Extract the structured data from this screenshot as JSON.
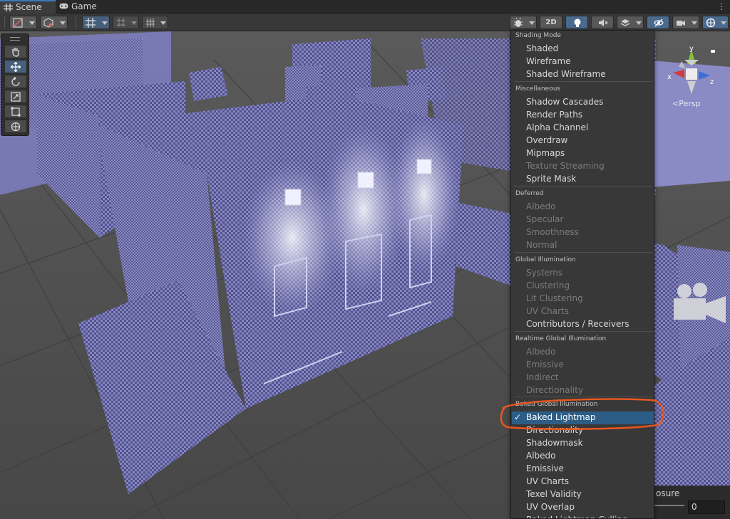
{
  "tabs": [
    {
      "label": "Scene",
      "icon": "scene-hash-icon",
      "active": true
    },
    {
      "label": "Game",
      "icon": "gamepad-icon",
      "active": false
    }
  ],
  "toolbar": {
    "render_mode_2d_label": "2D",
    "icons": [
      "draw-mode-icon",
      "shaded-cube-icon",
      "grid-snap-icon",
      "increment-snap-icon",
      "grid-icon",
      "debug-bug-icon",
      "light-bulb-icon",
      "audio-mute-icon",
      "effects-layers-icon",
      "visibility-off-icon",
      "camera-icon",
      "gizmos-globe-icon"
    ]
  },
  "tools": [
    "hand-tool-icon",
    "move-tool-icon",
    "rotate-tool-icon",
    "scale-tool-icon",
    "rect-tool-icon",
    "transform-tool-icon"
  ],
  "gizmo": {
    "label": "Persp",
    "axes": {
      "x": "x",
      "y": "y",
      "z": "z"
    },
    "colors": {
      "x": "#d23b3b",
      "y": "#7ec43c",
      "z": "#3b6fd6"
    }
  },
  "menu": {
    "sections": [
      {
        "header": "Shading Mode",
        "items": [
          {
            "label": "Shaded",
            "enabled": true
          },
          {
            "label": "Wireframe",
            "enabled": true
          },
          {
            "label": "Shaded Wireframe",
            "enabled": true
          }
        ]
      },
      {
        "header": "Miscellaneous",
        "items": [
          {
            "label": "Shadow Cascades",
            "enabled": true
          },
          {
            "label": "Render Paths",
            "enabled": true
          },
          {
            "label": "Alpha Channel",
            "enabled": true
          },
          {
            "label": "Overdraw",
            "enabled": true
          },
          {
            "label": "Mipmaps",
            "enabled": true
          },
          {
            "label": "Texture Streaming",
            "enabled": false
          },
          {
            "label": "Sprite Mask",
            "enabled": true
          }
        ]
      },
      {
        "header": "Deferred",
        "items": [
          {
            "label": "Albedo",
            "enabled": false
          },
          {
            "label": "Specular",
            "enabled": false
          },
          {
            "label": "Smoothness",
            "enabled": false
          },
          {
            "label": "Normal",
            "enabled": false
          }
        ]
      },
      {
        "header": "Global Illumination",
        "items": [
          {
            "label": "Systems",
            "enabled": false
          },
          {
            "label": "Clustering",
            "enabled": false
          },
          {
            "label": "Lit Clustering",
            "enabled": false
          },
          {
            "label": "UV Charts",
            "enabled": false
          },
          {
            "label": "Contributors / Receivers",
            "enabled": true
          }
        ]
      },
      {
        "header": "Realtime Global Illumination",
        "items": [
          {
            "label": "Albedo",
            "enabled": false
          },
          {
            "label": "Emissive",
            "enabled": false
          },
          {
            "label": "Indirect",
            "enabled": false
          },
          {
            "label": "Directionality",
            "enabled": false
          }
        ]
      },
      {
        "header": "Baked Global Illumination",
        "items": [
          {
            "label": "Baked Lightmap",
            "enabled": true,
            "selected": true
          },
          {
            "label": "Directionality",
            "enabled": true
          },
          {
            "label": "Shadowmask",
            "enabled": true
          },
          {
            "label": "Albedo",
            "enabled": true
          },
          {
            "label": "Emissive",
            "enabled": true
          },
          {
            "label": "UV Charts",
            "enabled": true
          },
          {
            "label": "Texel Validity",
            "enabled": true
          },
          {
            "label": "UV Overlap",
            "enabled": true
          },
          {
            "label": "Baked Lightmap Culling",
            "enabled": true
          }
        ]
      }
    ],
    "checkmark": "✓"
  },
  "exposure": {
    "label": "osure",
    "value": "0"
  },
  "colors": {
    "accent": "#2c5d87",
    "annotation": "#e8561e",
    "checker_light": "#8585c4",
    "checker_dark": "#52528a"
  }
}
